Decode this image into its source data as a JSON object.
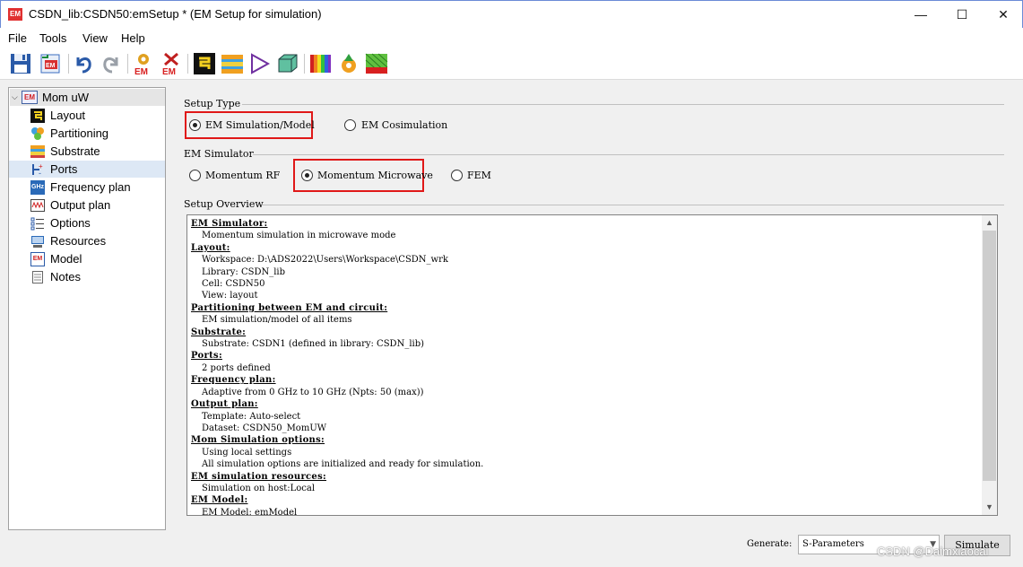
{
  "window": {
    "title": "CSDN_lib:CSDN50:emSetup * (EM Setup for simulation)",
    "app_icon": "EM",
    "minimize": "—",
    "maximize": "☐",
    "close": "✕"
  },
  "menu": [
    "File",
    "Tools",
    "View",
    "Help"
  ],
  "toolbar": {
    "em_label": "EM",
    "icons": [
      "save-icon",
      "em-import-icon",
      "undo-icon",
      "redo-icon",
      "em-settings-icon",
      "em-delete-icon",
      "layout-icon",
      "substrate-icon",
      "component-icon",
      "box-3d-icon",
      "visualization-icon",
      "gear-optimize-icon",
      "mesh-icon"
    ]
  },
  "tree": {
    "root": "Mom uW",
    "root_icon": "EM",
    "items": [
      {
        "label": "Layout",
        "icon": "layout-icon"
      },
      {
        "label": "Partitioning",
        "icon": "partitioning-icon"
      },
      {
        "label": "Substrate",
        "icon": "substrate-icon"
      },
      {
        "label": "Ports",
        "icon": "ports-icon"
      },
      {
        "label": "Frequency plan",
        "icon": "frequency-icon",
        "icon_text": "GHz"
      },
      {
        "label": "Output plan",
        "icon": "output-plan-icon"
      },
      {
        "label": "Options",
        "icon": "options-icon"
      },
      {
        "label": "Resources",
        "icon": "resources-icon"
      },
      {
        "label": "Model",
        "icon": "model-icon",
        "icon_text": "EM"
      },
      {
        "label": "Notes",
        "icon": "notes-icon"
      }
    ],
    "selected": "Ports"
  },
  "setup_type": {
    "label": "Setup Type",
    "options": [
      "EM Simulation/Model",
      "EM Cosimulation"
    ],
    "selected": "EM Simulation/Model"
  },
  "em_simulator": {
    "label": "EM Simulator",
    "options": [
      "Momentum RF",
      "Momentum Microwave",
      "FEM"
    ],
    "selected": "Momentum Microwave"
  },
  "overview": {
    "label": "Setup Overview",
    "sections": [
      {
        "heading": "EM Simulator:",
        "lines": [
          "Momentum simulation in microwave mode"
        ]
      },
      {
        "heading": "Layout:",
        "lines": [
          "Workspace: D:\\ADS2022\\Users\\Workspace\\CSDN_wrk",
          "Library: CSDN_lib",
          "Cell: CSDN50",
          "View: layout"
        ]
      },
      {
        "heading": "Partitioning between EM and circuit:",
        "lines": [
          "EM simulation/model of all items"
        ]
      },
      {
        "heading": "Substrate:",
        "lines": [
          "Substrate: CSDN1 (defined in library: CSDN_lib)"
        ]
      },
      {
        "heading": "Ports:",
        "lines": [
          "2 ports defined"
        ]
      },
      {
        "heading": "Frequency plan:",
        "lines": [
          "Adaptive from 0 GHz to 10 GHz (Npts: 50 (max))"
        ]
      },
      {
        "heading": "Output plan:",
        "lines": [
          "Template: Auto-select",
          "Dataset: CSDN50_MomUW"
        ]
      },
      {
        "heading": "Mom Simulation options:",
        "lines": [
          "Using local settings",
          "All simulation options are initialized and ready for simulation."
        ]
      },
      {
        "heading": "EM simulation resources:",
        "lines": [
          "Simulation on host:Local"
        ]
      },
      {
        "heading": "EM Model:",
        "lines": [
          "EM Model: emModel"
        ]
      }
    ]
  },
  "footer": {
    "generate_label": "Generate:",
    "generate_value": "S-Parameters",
    "simulate_label": "Simulate"
  },
  "watermark": "CSDN @Daimxiaocai",
  "colors": {
    "highlight": "#e01818",
    "accent": "#6b8bd6",
    "selected": "#dde8f5"
  }
}
